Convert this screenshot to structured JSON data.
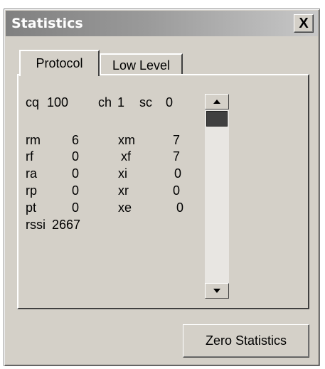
{
  "window": {
    "title": "Statistics",
    "close_label": "X"
  },
  "tabs": [
    {
      "label": "Protocol",
      "selected": true
    },
    {
      "label": "Low Level",
      "selected": false
    }
  ],
  "header_stats": {
    "cq_label": "cq",
    "cq_value": "100",
    "ch_label": "ch",
    "ch_value": "1",
    "sc_label": "sc",
    "sc_value": "0"
  },
  "stats_left": [
    {
      "label": "rm",
      "value": "6"
    },
    {
      "label": "rf",
      "value": "0"
    },
    {
      "label": "ra",
      "value": "0"
    },
    {
      "label": "rp",
      "value": "0"
    },
    {
      "label": "pt",
      "value": "0"
    }
  ],
  "stats_right": [
    {
      "label": "xm",
      "value": "7"
    },
    {
      "label": "xf",
      "value": "7"
    },
    {
      "label": "xi",
      "value": "0"
    },
    {
      "label": "xr",
      "value": "0"
    },
    {
      "label": "xe",
      "value": "0"
    }
  ],
  "rssi": {
    "label": "rssi",
    "value": "2667"
  },
  "buttons": {
    "zero_statistics": "Zero Statistics"
  }
}
